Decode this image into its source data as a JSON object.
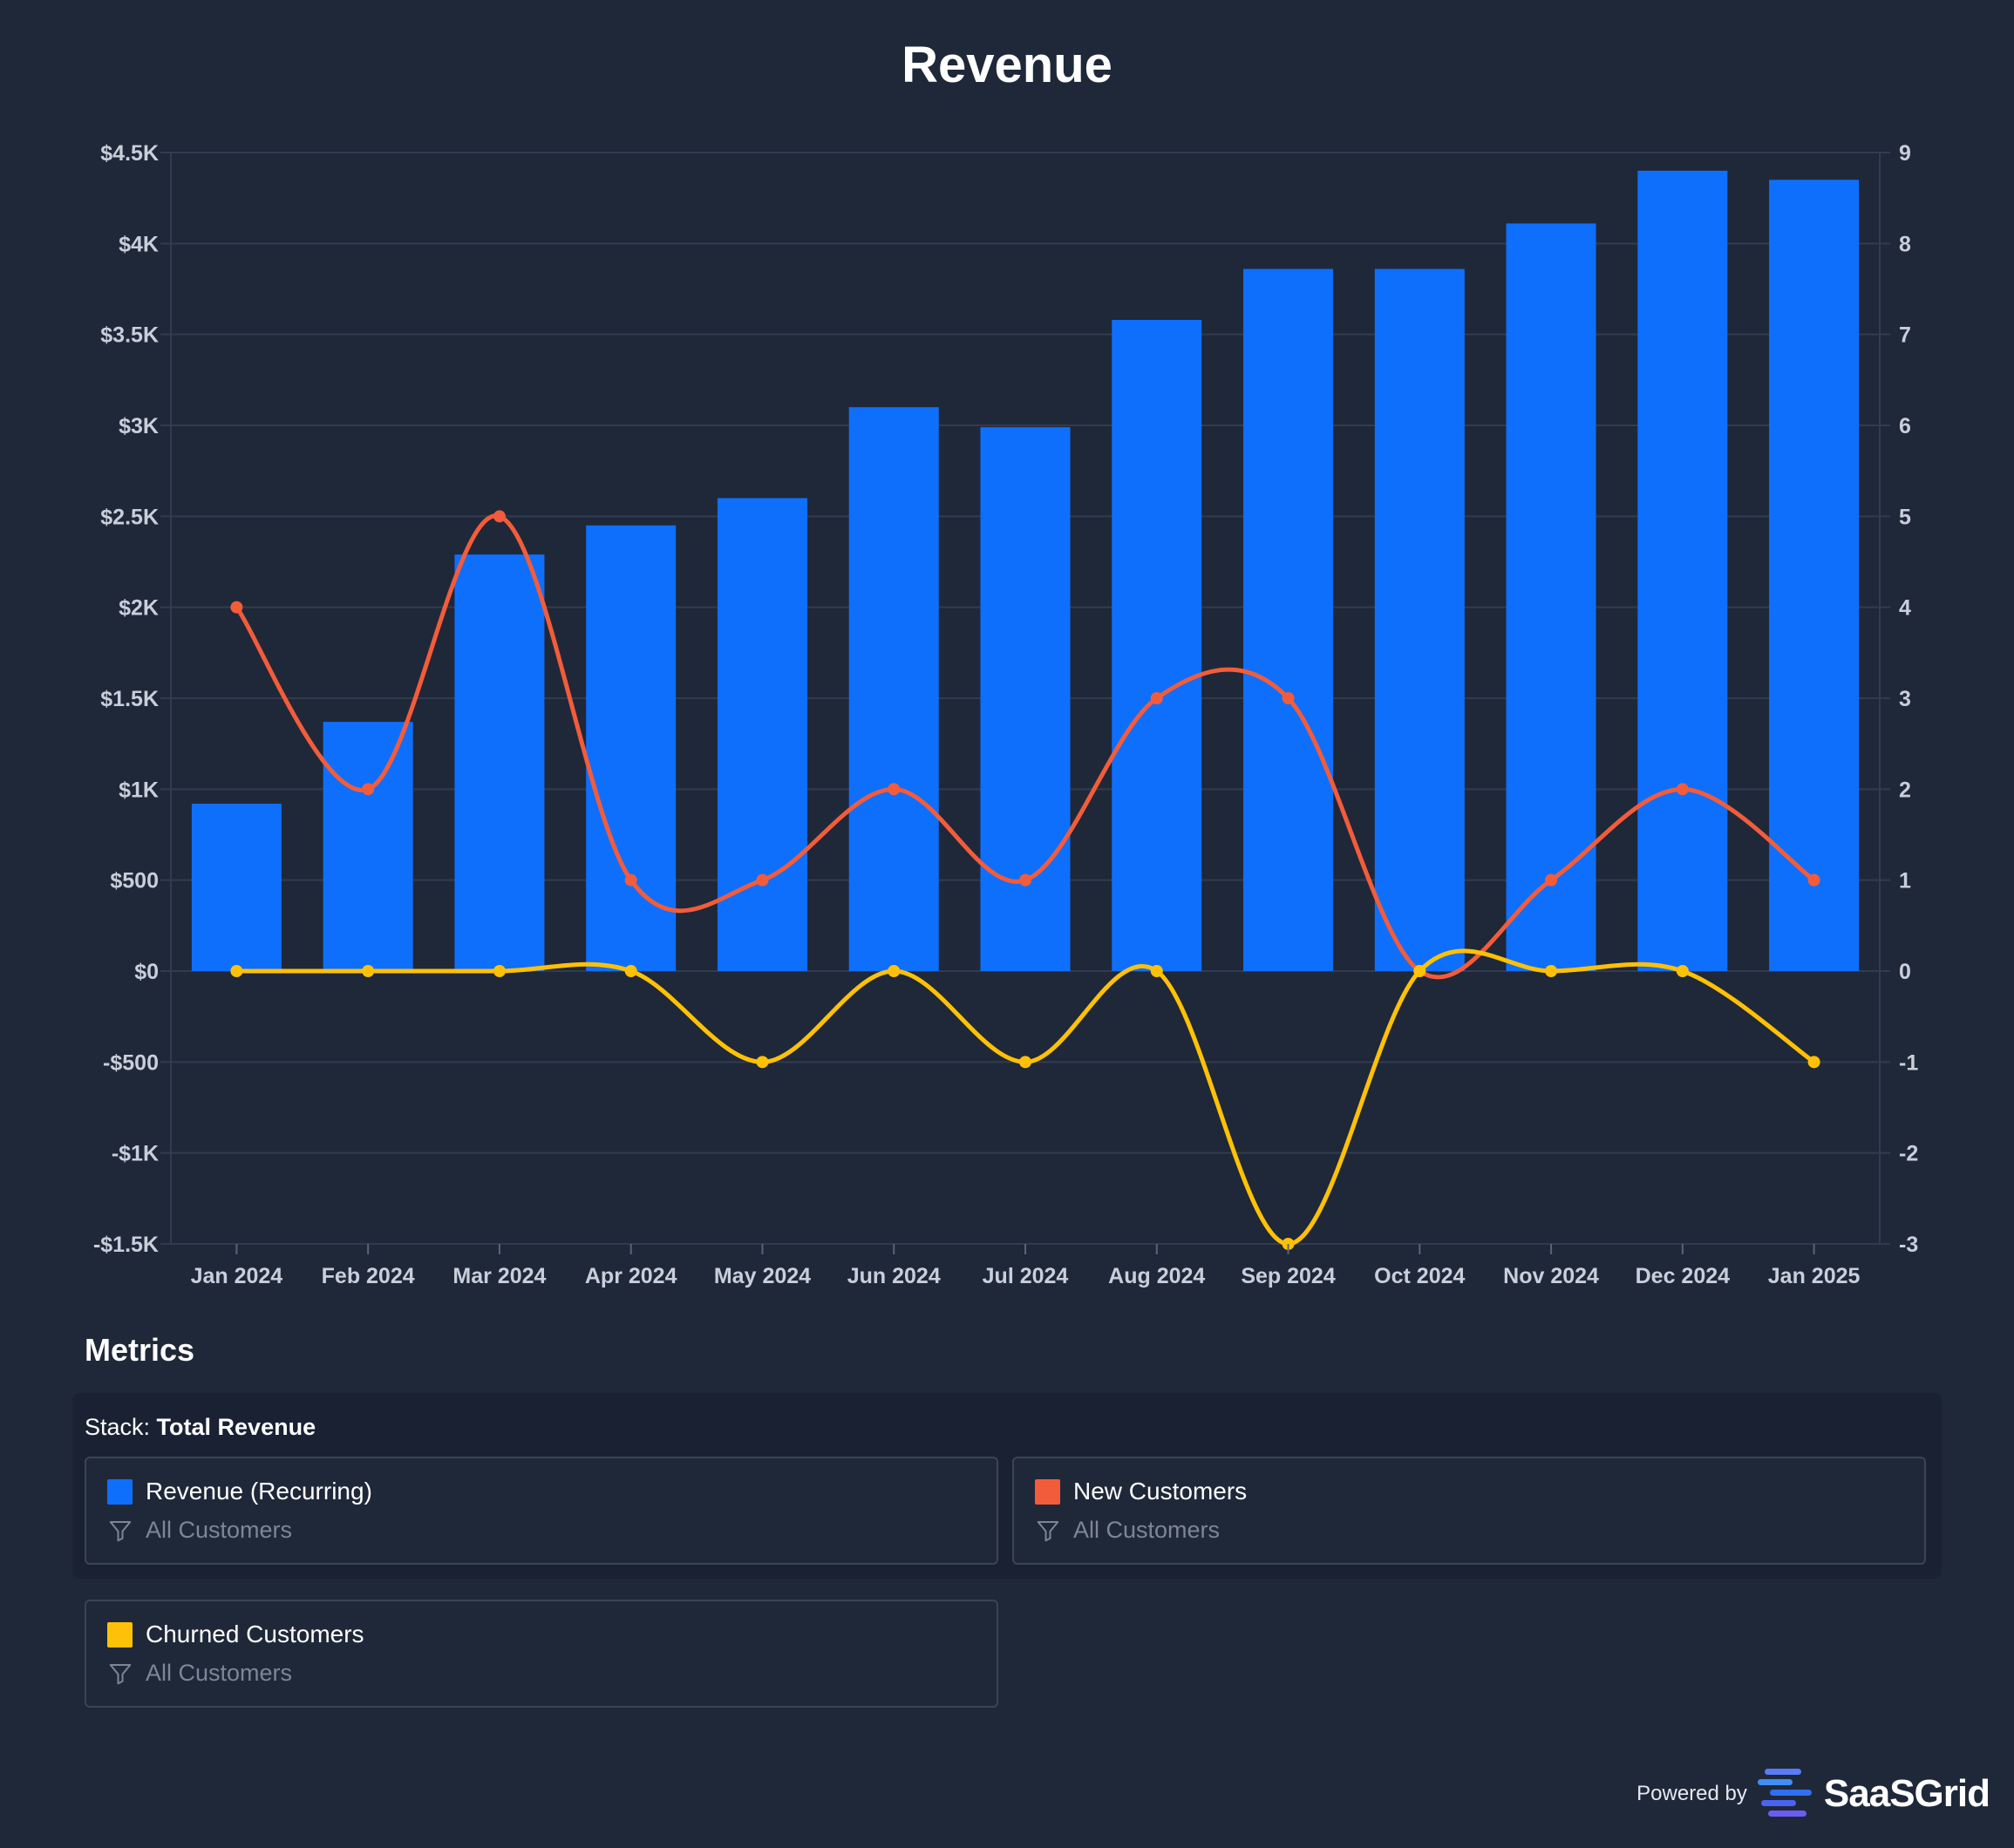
{
  "chart_data": {
    "type": "bar",
    "title": "Revenue",
    "categories": [
      "Jan 2024",
      "Feb 2024",
      "Mar 2024",
      "Apr 2024",
      "May 2024",
      "Jun 2024",
      "Jul 2024",
      "Aug 2024",
      "Sep 2024",
      "Oct 2024",
      "Nov 2024",
      "Dec 2024",
      "Jan 2025"
    ],
    "series": [
      {
        "name": "Revenue (Recurring)",
        "type": "bar",
        "axis": "left",
        "color": "#0f6ffd",
        "values": [
          920,
          1370,
          2290,
          2450,
          2600,
          3100,
          2990,
          3580,
          3860,
          3860,
          4110,
          4400,
          4350
        ]
      },
      {
        "name": "New Customers",
        "type": "line",
        "axis": "right",
        "color": "#f35c3a",
        "values": [
          4,
          2,
          5,
          1,
          1,
          2,
          1,
          3,
          3,
          0,
          1,
          2,
          1
        ]
      },
      {
        "name": "Churned Customers",
        "type": "line",
        "axis": "right",
        "color": "#ffc107",
        "values": [
          0,
          0,
          0,
          0,
          -1,
          0,
          -1,
          0,
          -3,
          0,
          0,
          0,
          -1
        ]
      }
    ],
    "y_left": {
      "min": -1500,
      "max": 4500,
      "ticks": [
        {
          "value": 4500,
          "label": "$4.5K"
        },
        {
          "value": 4000,
          "label": "$4K"
        },
        {
          "value": 3500,
          "label": "$3.5K"
        },
        {
          "value": 3000,
          "label": "$3K"
        },
        {
          "value": 2500,
          "label": "$2.5K"
        },
        {
          "value": 2000,
          "label": "$2K"
        },
        {
          "value": 1500,
          "label": "$1.5K"
        },
        {
          "value": 1000,
          "label": "$1K"
        },
        {
          "value": 500,
          "label": "$500"
        },
        {
          "value": 0,
          "label": "$0"
        },
        {
          "value": -500,
          "label": "-$500"
        },
        {
          "value": -1000,
          "label": "-$1K"
        },
        {
          "value": -1500,
          "label": "-$1.5K"
        }
      ]
    },
    "y_right": {
      "min": -3,
      "max": 9,
      "ticks": [
        {
          "value": 9,
          "label": "9"
        },
        {
          "value": 8,
          "label": "8"
        },
        {
          "value": 7,
          "label": "7"
        },
        {
          "value": 6,
          "label": "6"
        },
        {
          "value": 5,
          "label": "5"
        },
        {
          "value": 4,
          "label": "4"
        },
        {
          "value": 3,
          "label": "3"
        },
        {
          "value": 2,
          "label": "2"
        },
        {
          "value": 1,
          "label": "1"
        },
        {
          "value": 0,
          "label": "0"
        },
        {
          "value": -1,
          "label": "-1"
        },
        {
          "value": -2,
          "label": "-2"
        },
        {
          "value": -3,
          "label": "-3"
        }
      ]
    },
    "grid": true,
    "background": "#1f2839",
    "grid_color": "#323c4e"
  },
  "metrics": {
    "title": "Metrics",
    "stack_prefix": "Stack:",
    "stack_name": "Total Revenue",
    "items": [
      {
        "name": "Revenue (Recurring)",
        "filter": "All Customers",
        "color": "#0f6ffd"
      },
      {
        "name": "New Customers",
        "filter": "All Customers",
        "color": "#f35c3a"
      },
      {
        "name": "Churned Customers",
        "filter": "All Customers",
        "color": "#ffc107"
      }
    ]
  },
  "footer": {
    "powered_by": "Powered by",
    "brand": "SaaSGrid"
  }
}
